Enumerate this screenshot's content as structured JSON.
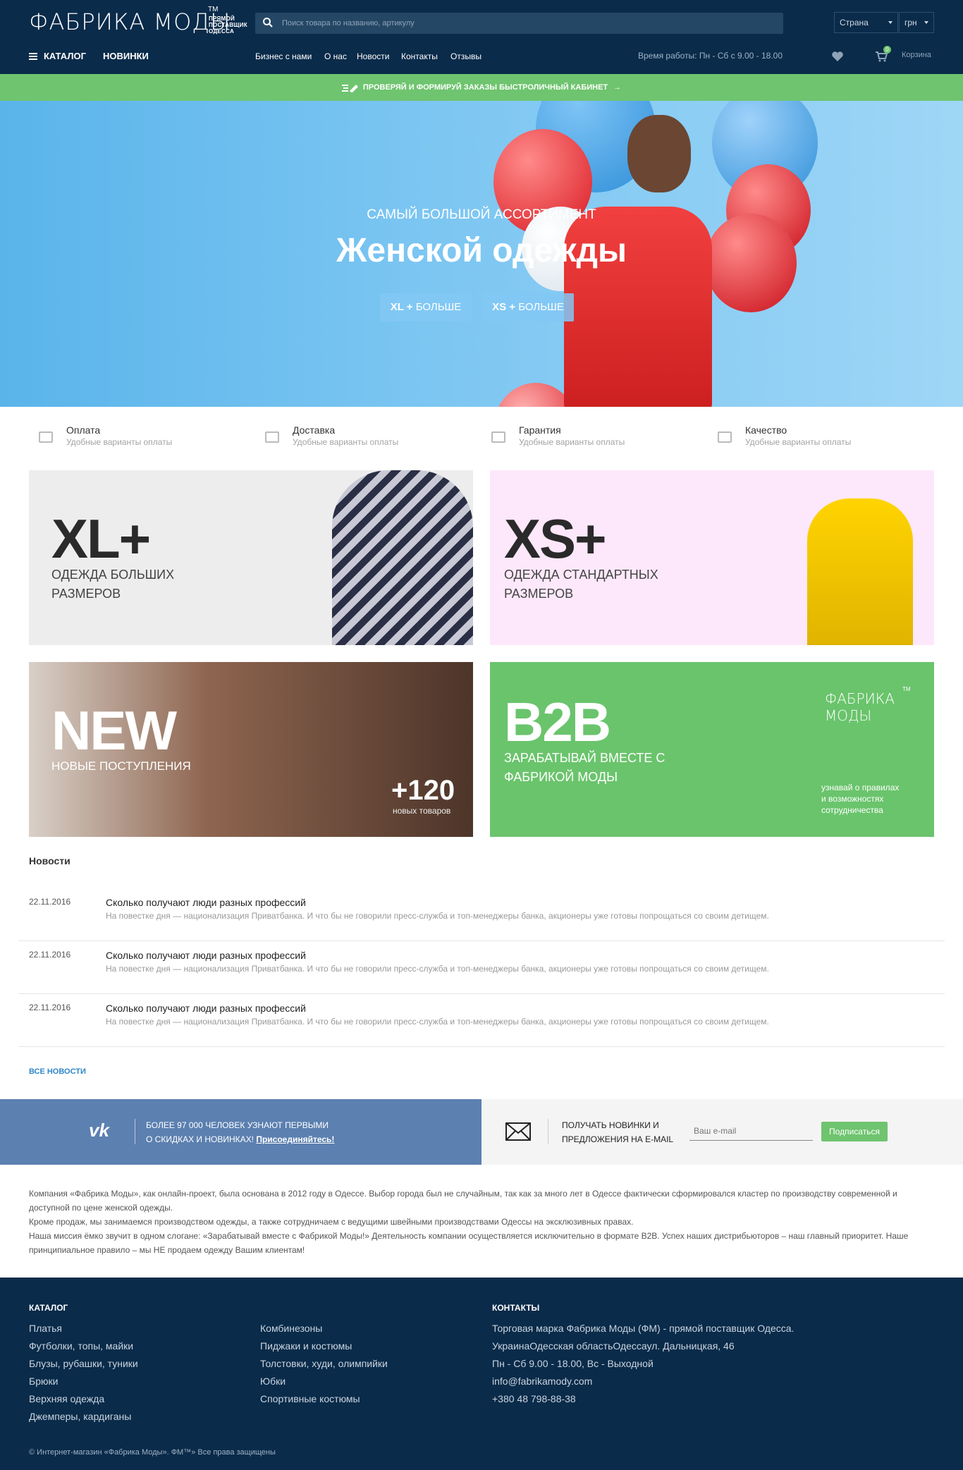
{
  "header": {
    "logo_text": "ФАБРИКА МОДЫ",
    "logo_tm": "TM",
    "logo_tagline": [
      "ПРЯМОЙ",
      "ПОСТАВЩИК",
      "ОДЕССА"
    ],
    "search_placeholder": "Поиск товара по названию, артикулу",
    "country_select": "Страна",
    "currency_select": "грн",
    "catalog_label": "КАТАЛОГ",
    "new_label": "НОВИНКИ",
    "links": [
      "Бизнес с нами",
      "О нас",
      "Новости",
      "Контакты",
      "Отзывы"
    ],
    "hours": "Время работы: Пн - Сб с 9.00 - 18.00",
    "cart_count": "0",
    "cart_label": "Корзина"
  },
  "promo_bar": {
    "text": "ПРОВЕРЯЙ И ФОРМИРУЙ ЗАКАЗЫ БЫСТРО",
    "link": "ЛИЧНЫЙ КАБИНЕТ"
  },
  "hero": {
    "subtitle": "САМЫЙ БОЛЬШОЙ АССОРТИМЕНТ",
    "title": "Женской одежды",
    "btn1_bold": "XL +",
    "btn1_text": "БОЛЬШЕ",
    "btn2_bold": "XS +",
    "btn2_text": "БОЛЬШЕ"
  },
  "features": [
    {
      "title": "Оплата",
      "sub": "Удобные варианты оплаты"
    },
    {
      "title": "Доставка",
      "sub": "Удобные варианты оплаты"
    },
    {
      "title": "Гарантия",
      "sub": "Удобные варианты оплаты"
    },
    {
      "title": "Качество",
      "sub": "Удобные варианты оплаты"
    }
  ],
  "tiles": {
    "xl": {
      "big": "XL+",
      "line1": "ОДЕЖДА БОЛЬШИХ",
      "line2": "РАЗМЕРОВ"
    },
    "xs": {
      "big": "XS+",
      "line1": "ОДЕЖДА СТАНДАРТНЫХ",
      "line2": "РАЗМЕРОВ"
    },
    "new": {
      "big": "NEW",
      "sub": "НОВЫЕ ПОСТУПЛЕНИЯ",
      "count": "+120",
      "count_sub": "новых товаров"
    },
    "b2b": {
      "big": "B2B",
      "line1": "ЗАРАБАТЫВАЙ ВМЕСТЕ С",
      "line2": "ФАБРИКОЙ МОДЫ",
      "logo_l1": "ФАБРИКА",
      "logo_l2": "МОДЫ",
      "logo_tm": "TM",
      "note": [
        "узнавай о правилах",
        "и возможностях",
        "сотрудничества"
      ]
    }
  },
  "news": {
    "heading": "Новости",
    "items": [
      {
        "date": "22.11.2016",
        "title": "Сколько получают люди разных профессий",
        "text": "На повестке дня — национализация Приватбанка. И что бы не говорили пресс-служба и топ-менеджеры банка, акционеры уже готовы попрощаться со своим детищем."
      },
      {
        "date": "22.11.2016",
        "title": "Сколько получают люди разных профессий",
        "text": "На повестке дня — национализация Приватбанка. И что бы не говорили пресс-служба и топ-менеджеры банка, акционеры уже готовы попрощаться со своим детищем."
      },
      {
        "date": "22.11.2016",
        "title": "Сколько получают люди разных профессий",
        "text": "На повестке дня — национализация Приватбанка. И что бы не говорили пресс-служба и топ-менеджеры банка, акционеры уже готовы попрощаться со своим детищем."
      }
    ],
    "all_link": "ВСЕ НОВОСТИ"
  },
  "subscribe": {
    "vk_line1": "БОЛЕЕ 97 000 ЧЕЛОВЕК УЗНАЮТ ПЕРВЫМИ",
    "vk_line2": "О СКИДКАХ И НОВИНКАХ!",
    "vk_link": "Присоединяйтесь!",
    "mail_line1": "ПОЛУЧАТЬ НОВИНКИ И",
    "mail_line2": "ПРЕДЛОЖЕНИЯ НА E-MAIL",
    "email_placeholder": "Ваш e-mail",
    "button": "Подписаться"
  },
  "about": [
    "Компания «Фабрика Моды», как онлайн-проект, была основана в 2012 году в Одессе. Выбор города был не случайным, так как за много лет в Одессе фактически сформировался кластер по производству современной и доступной по цене женской одежды.",
    "Кроме продаж, мы занимаемся производством одежды, а также сотрудничаем с ведущими швейными производствами Одессы на эксклюзивных правах.",
    "Наша миссия ёмко звучит в одном слогане: «Зарабатывай вместе с Фабрикой Моды!» Деятельность компании осуществляется исключительно в формате B2B. Успех наших дистрибьюторов – наш главный приоритет. Наше принципиальное правило – мы НЕ продаем одежду Вашим клиентам!"
  ],
  "footer": {
    "catalog_heading": "КАТАЛОГ",
    "col1": [
      "Платья",
      "Футболки, топы, майки",
      "Блузы, рубашки, туники",
      "Брюки",
      "Верхняя одежда",
      "Джемперы, кардиганы"
    ],
    "col2": [
      "Комбинезоны",
      "Пиджаки и костюмы",
      "Толстовки, худи, олимпийки",
      "Юбки",
      "Спортивные костюмы"
    ],
    "contacts_heading": "КОНТАКТЫ",
    "contacts": [
      "Торговая марка Фабрика Моды (ФМ) - прямой поставщик Одесса.",
      "УкраинаОдесская областьОдессаул. Дальницкая, 46",
      "Пн - Сб 9.00 - 18.00, Вс - Выходной",
      "info@fabrikamody.com",
      "+380 48 798-88-38"
    ],
    "copyright": "© Интернет-магазин «Фабрика Моды». ФМ™» Все права защищены"
  },
  "colors": {
    "header_bg": "#0a2b4a",
    "green": "#6fc46f",
    "vk": "#5c80b0",
    "hero_blue": "#6abdee"
  }
}
